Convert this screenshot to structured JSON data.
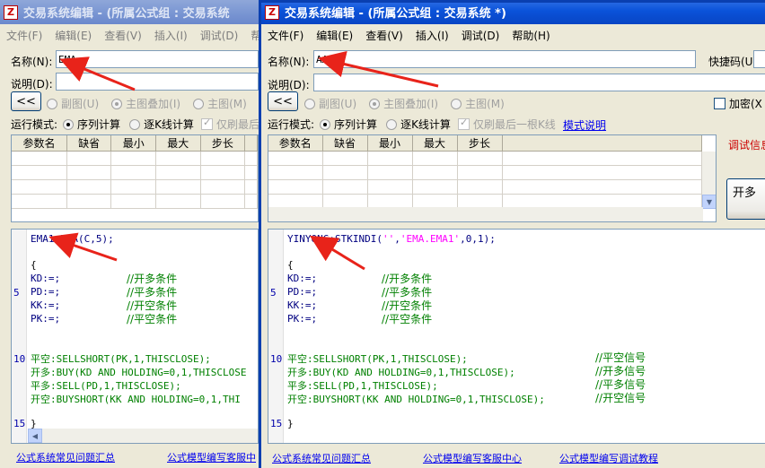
{
  "back_window": {
    "title": "交易系统编辑 - (所属公式组 : 交易系统",
    "menu": [
      "文件(F)",
      "编辑(E)",
      "查看(V)",
      "插入(I)",
      "调试(D)",
      "帮"
    ],
    "name_label": "名称(N):",
    "name_value": "EMA",
    "desc_label": "说明(D):",
    "collapse_btn": "<<",
    "chart_options": [
      "副图(U)",
      "主图叠加(I)",
      "主图(M)"
    ],
    "run_mode_label": "运行模式:",
    "run_options": [
      "序列计算",
      "逐K线计算"
    ],
    "only_last": "仅刷最后",
    "param_headers": [
      "参数名",
      "缺省",
      "最小",
      "最大",
      "步长"
    ],
    "code_lines": [
      "EMA1:EMA(C,5);",
      "{",
      "KD:=;",
      "PD:=;",
      "KK:=;",
      "PK:=;",
      "平空:SELLSHORT(PK,1,THISCLOSE);",
      "开多:BUY(KD AND HOLDING=0,1,THISCLOSE",
      "平多:SELL(PD,1,THISCLOSE);",
      "开空:BUYSHORT(KK AND HOLDING=0,1,THI",
      "}"
    ],
    "comments": [
      "//开多条件",
      "//平多条件",
      "//开空条件",
      "//平空条件"
    ],
    "line_numbers": [
      "5",
      "10",
      "15"
    ],
    "footer_links": [
      "公式系统常见问题汇总",
      "公式模型编写客服中"
    ]
  },
  "front_window": {
    "title": "交易系统编辑 - (所属公式组 : 交易系统 *)",
    "menu": [
      "文件(F)",
      "编辑(E)",
      "查看(V)",
      "插入(I)",
      "调试(D)",
      "帮助(H)"
    ],
    "name_label": "名称(N):",
    "name_value": "AAA",
    "shortcut_label": "快捷码(U)",
    "desc_label": "说明(D):",
    "collapse_btn": "<<",
    "chart_options": [
      "副图(U)",
      "主图叠加(I)",
      "主图(M)"
    ],
    "encrypt_label": "加密(X",
    "run_mode_label": "运行模式:",
    "run_options": [
      "序列计算",
      "逐K线计算"
    ],
    "only_last": "仅刷最后一根K线",
    "mode_help_link": "模式说明",
    "param_headers": [
      "参数名",
      "缺省",
      "最小",
      "最大",
      "步长"
    ],
    "debug_info": "调试信息",
    "open_long_btn": "开多",
    "code_first_prefix": "YINYONG:STKINDI(",
    "code_first_str1": "''",
    "code_first_sep": ",",
    "code_first_str2": "'EMA.EMA1'",
    "code_first_suffix": ",0,1);",
    "code_lines": [
      "{",
      "KD:=;",
      "PD:=;",
      "KK:=;",
      "PK:=;",
      "平空:SELLSHORT(PK,1,THISCLOSE);",
      "开多:BUY(KD AND HOLDING=0,1,THISCLOSE);",
      "平多:SELL(PD,1,THISCLOSE);",
      "开空:BUYSHORT(KK AND HOLDING=0,1,THISCLOSE);",
      "}"
    ],
    "comments": [
      "//开多条件",
      "//平多条件",
      "//开空条件",
      "//平空条件"
    ],
    "signal_comments": [
      "//平空信号",
      "//开多信号",
      "//平多信号",
      "//开空信号"
    ],
    "line_numbers": [
      "5",
      "10",
      "15"
    ],
    "footer_links": [
      "公式系统常见问题汇总",
      "公式模型编写客服中心",
      "公式模型编写调试教程"
    ]
  },
  "colors": {
    "annotation_arrow": "#e8231a",
    "titlebar_active": "#0a52d9",
    "titlebar_inactive": "#7b97d3"
  }
}
